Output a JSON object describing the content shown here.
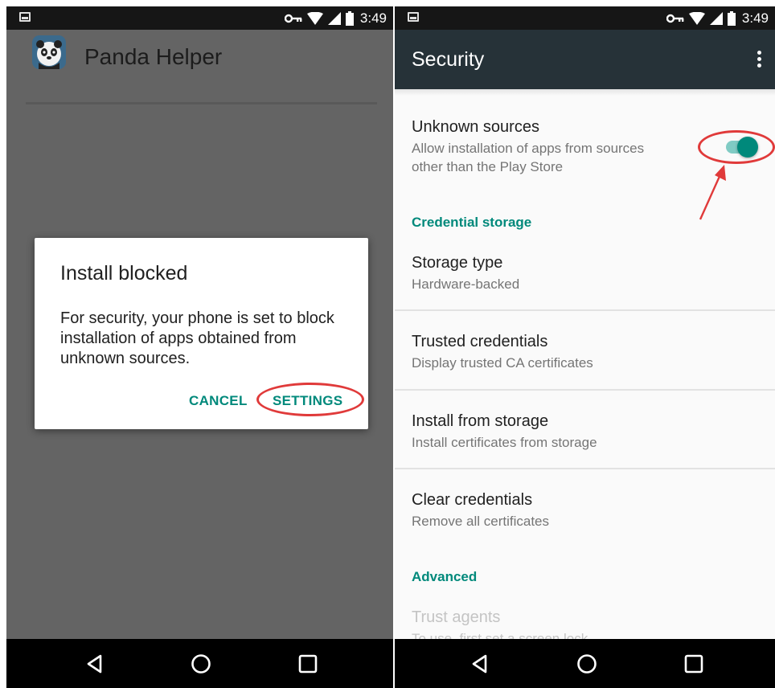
{
  "status_bar": {
    "time": "3:49"
  },
  "left_screen": {
    "app_title": "Panda Helper",
    "dialog": {
      "title": "Install blocked",
      "message": "For security, your phone is set to block installation of apps obtained from unknown sources.",
      "cancel_label": "CANCEL",
      "settings_label": "SETTINGS"
    }
  },
  "right_screen": {
    "toolbar_title": "Security",
    "unknown_sources": {
      "title": "Unknown sources",
      "summary_line1": "Allow installation of apps from sources",
      "summary_line2": "other than the Play Store",
      "enabled": true
    },
    "categories": {
      "credential_storage": "Credential storage",
      "advanced": "Advanced"
    },
    "prefs": [
      {
        "title": "Storage type",
        "summary": "Hardware-backed"
      },
      {
        "title": "Trusted credentials",
        "summary": "Display trusted CA certificates"
      },
      {
        "title": "Install from storage",
        "summary": "Install certificates from storage"
      },
      {
        "title": "Clear credentials",
        "summary": "Remove all certificates"
      },
      {
        "title": "Trust agents",
        "summary": "To use, first set a screen lock"
      }
    ]
  },
  "colors": {
    "accent": "#00897b",
    "toolbar": "#263238",
    "annotation": "#e03a3a"
  },
  "icons": [
    "image-icon",
    "vpn-key-icon",
    "wifi-icon",
    "cell-signal-icon",
    "battery-icon",
    "overflow-menu-icon",
    "back-icon",
    "home-icon",
    "recents-icon",
    "panda-app-icon"
  ]
}
